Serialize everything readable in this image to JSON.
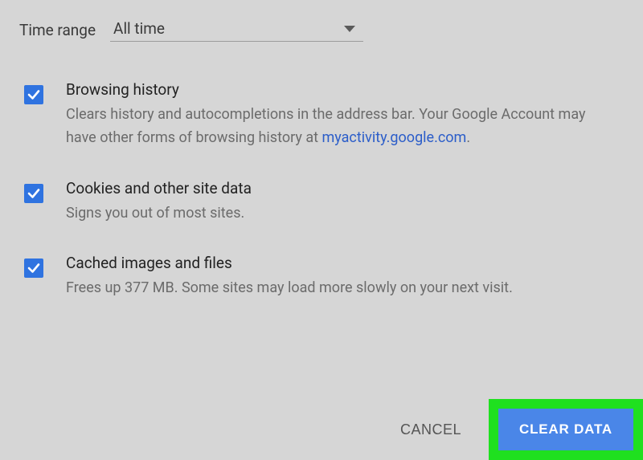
{
  "timeRange": {
    "label": "Time range",
    "value": "All time"
  },
  "options": [
    {
      "title": "Browsing history",
      "descPrefix": "Clears history and autocompletions in the address bar. Your Google Account may have other forms of browsing history at ",
      "link": "myactivity.google.com",
      "descSuffix": "."
    },
    {
      "title": "Cookies and other site data",
      "desc": "Signs you out of most sites."
    },
    {
      "title": "Cached images and files",
      "desc": "Frees up 377 MB. Some sites may load more slowly on your next visit."
    }
  ],
  "footer": {
    "cancel": "CANCEL",
    "clear": "CLEAR DATA"
  }
}
